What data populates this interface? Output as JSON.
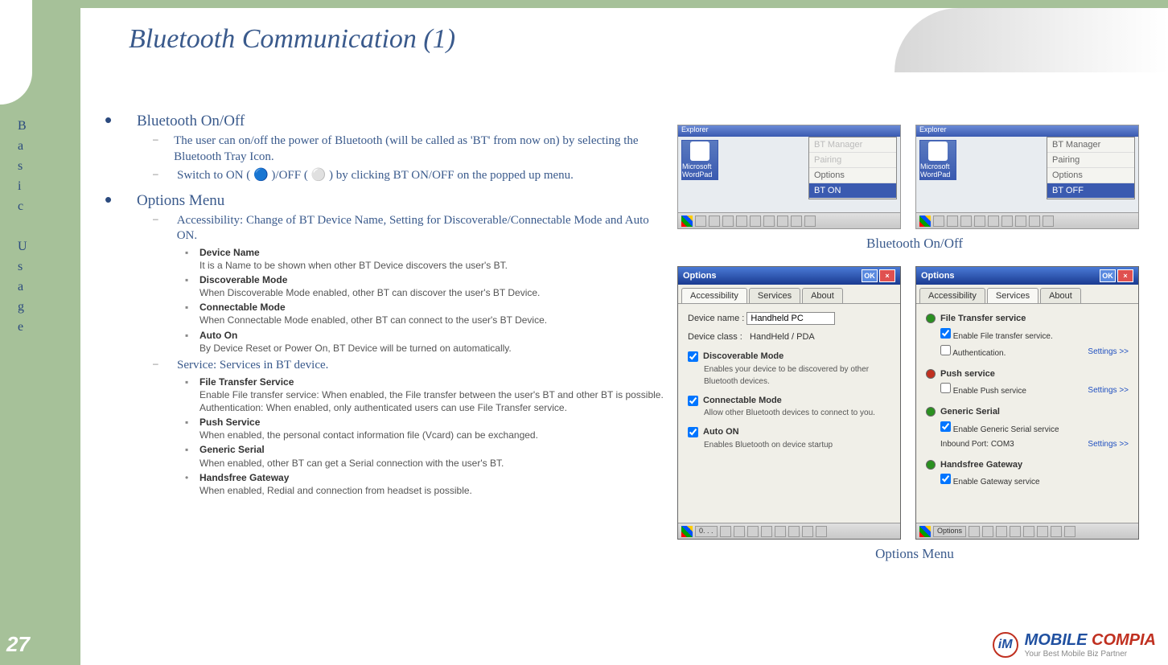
{
  "pageNumber": "27",
  "sidebarText": "Basic Usage",
  "title": "Bluetooth Communication (1)",
  "sections": [
    {
      "heading": "Bluetooth On/Off",
      "subs": [
        {
          "text": "The user can on/off the power of Bluetooth (will be called as 'BT' from now on) by selecting the Bluetooth Tray Icon."
        },
        {
          "text": "Switch to ON ( 🔵 )/OFF ( ⚪ ) by clicking BT ON/OFF on the popped up menu."
        }
      ]
    },
    {
      "heading": "Options Menu",
      "subs": [
        {
          "text": "Accessibility: Change of BT Device Name, Setting for Discoverable/Connectable Mode and Auto ON.",
          "items": [
            {
              "title": "Device Name",
              "desc": "It is a Name to be shown when other BT Device discovers the user's BT."
            },
            {
              "title": "Discoverable Mode",
              "desc": "When Discoverable Mode enabled, other BT can discover the user's BT Device."
            },
            {
              "title": "Connectable Mode",
              "desc": "When Connectable Mode enabled, other BT can connect to the user's BT Device."
            },
            {
              "title": "Auto On",
              "desc": "By Device Reset or Power On, BT Device will be turned on automatically."
            }
          ]
        },
        {
          "text": "Service: Services in BT device.",
          "items": [
            {
              "title": "File Transfer Service",
              "desc": "Enable File transfer service: When enabled, the File transfer between the user's BT and other BT is possible.",
              "desc2": "Authentication: When enabled, only authenticated users can use File Transfer service."
            },
            {
              "title": "Push Service",
              "desc": "When enabled, the personal contact information file (Vcard) can be exchanged."
            },
            {
              "title": "Generic Serial",
              "desc": "When enabled, other BT can get a Serial connection with the user's BT."
            },
            {
              "title": "Handsfree Gateway",
              "desc": "When enabled, Redial and connection from headset is possible.",
              "bullet": "•"
            }
          ]
        }
      ]
    }
  ],
  "captions": {
    "topRow": "Bluetooth On/Off",
    "bottomRow": "Options Menu"
  },
  "screenshots": {
    "menuLeft": {
      "icons": [
        "Microsoft WordPad"
      ],
      "menu": [
        "BT Manager",
        "Pairing",
        "Options",
        "BT ON"
      ],
      "disabled": [
        0,
        1
      ],
      "active": 3
    },
    "menuRight": {
      "icons": [
        "Microsoft WordPad"
      ],
      "menu": [
        "BT Manager",
        "Pairing",
        "Options",
        "BT OFF"
      ],
      "active": 3
    },
    "optionsAccess": {
      "title": "Options",
      "tabs": [
        "Accessibility",
        "Services",
        "About"
      ],
      "activeTab": 0,
      "deviceNameLabel": "Device name   :",
      "deviceNameValue": "Handheld PC",
      "deviceClassLabel": "Device class   :",
      "deviceClassValue": "HandHeld / PDA",
      "checks": [
        {
          "label": "Discoverable Mode",
          "desc": "Enables your device to be discovered by other Bluetooth devices.",
          "checked": true
        },
        {
          "label": "Connectable Mode",
          "desc": "Allow other Bluetooth devices to connect to you.",
          "checked": true
        },
        {
          "label": "Auto ON",
          "desc": "Enables Bluetooth on device startup",
          "checked": true
        }
      ],
      "taskLabel": "0. . ."
    },
    "optionsServices": {
      "title": "Options",
      "tabs": [
        "Accessibility",
        "Services",
        "About"
      ],
      "activeTab": 1,
      "services": [
        {
          "name": "File Transfer service",
          "dot": "g",
          "rows": [
            {
              "chk": true,
              "text": "Enable File transfer service."
            },
            {
              "chk": false,
              "text": "Authentication.",
              "link": "Settings >>"
            }
          ]
        },
        {
          "name": "Push service",
          "dot": "r",
          "rows": [
            {
              "chk": false,
              "text": "Enable Push service",
              "link": "Settings >>"
            }
          ]
        },
        {
          "name": "Generic Serial",
          "dot": "g",
          "rows": [
            {
              "chk": true,
              "text": "Enable Generic Serial service"
            },
            {
              "text": "Inbound Port: COM3",
              "link": "Settings >>"
            }
          ]
        },
        {
          "name": "Handsfree Gateway",
          "dot": "g",
          "rows": [
            {
              "chk": true,
              "text": "Enable Gateway service"
            }
          ]
        }
      ],
      "taskLabel": "Options"
    }
  },
  "logo": {
    "brand1": "MOBILE ",
    "brand2": "COMPIA",
    "tagline": "Your Best Mobile Biz Partner",
    "mark": "iM"
  }
}
